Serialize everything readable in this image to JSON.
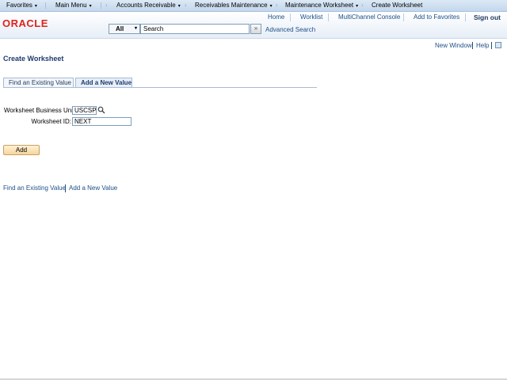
{
  "menubar": {
    "favorites": "Favorites",
    "main_menu": "Main Menu",
    "breadcrumbs": [
      "Accounts Receivable",
      "Receivables Maintenance",
      "Maintenance Worksheet",
      "Create Worksheet"
    ]
  },
  "header": {
    "logo": "ORACLE",
    "links": [
      "Home",
      "Worklist",
      "MultiChannel Console",
      "Add to Favorites"
    ],
    "sign_out": "Sign out",
    "search_scope": "All",
    "search_value": "Search",
    "go_symbol": "»",
    "advanced_search": "Advanced Search"
  },
  "utility": {
    "new_window": "New Window",
    "help": "Help"
  },
  "page": {
    "title": "Create Worksheet",
    "tabs": [
      {
        "label": "Find an Existing Value",
        "active": false
      },
      {
        "label": "Add a New Value",
        "active": true
      }
    ],
    "fields": {
      "business_unit_label": "Worksheet Business Unit:",
      "business_unit_value": "USCSP",
      "worksheet_id_label": "Worksheet ID:",
      "worksheet_id_value": "NEXT"
    },
    "add_button": "Add",
    "bottom_links": [
      "Find an Existing Value",
      "Add a New Value"
    ]
  },
  "icons": {
    "dropdown": "▾",
    "lookup": "magnifier-icon",
    "breadcrumb_separator": "›"
  }
}
